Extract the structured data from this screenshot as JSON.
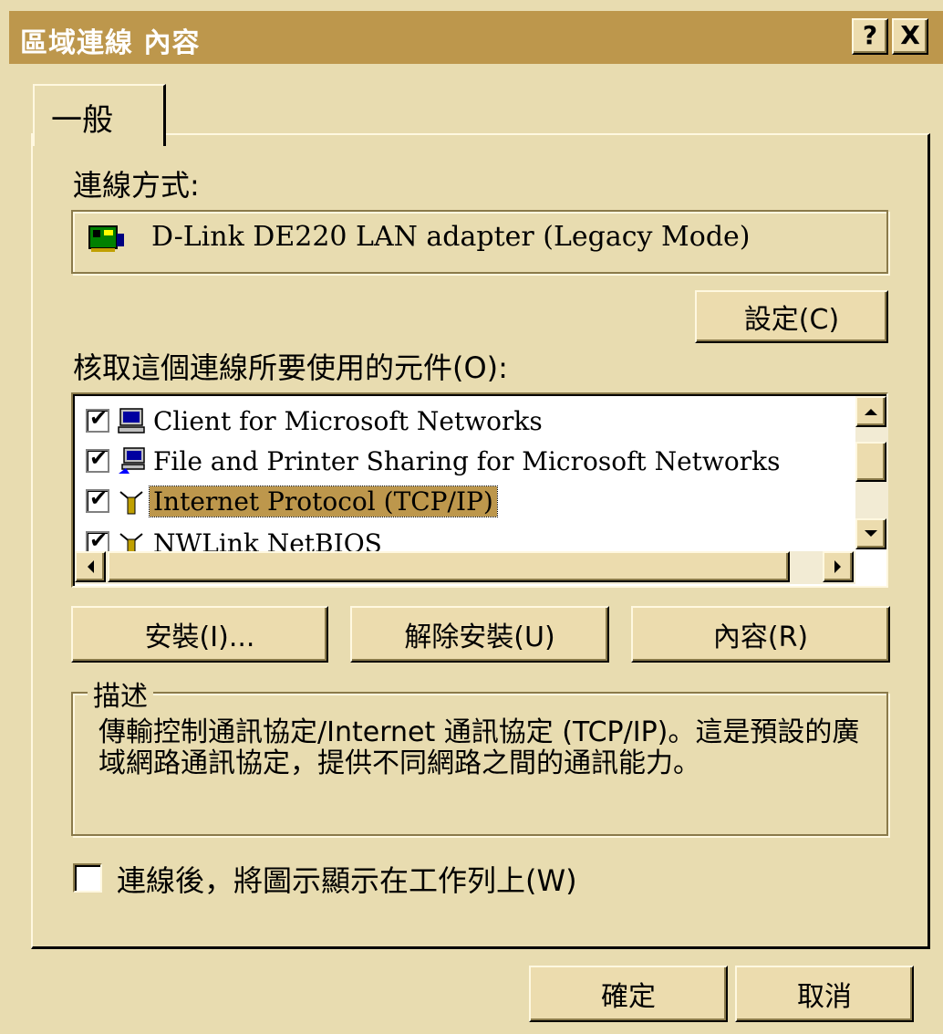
{
  "window": {
    "title": "區域連線 內容",
    "help_glyph": "?",
    "close_glyph": "X"
  },
  "tabs": [
    {
      "label": "一般"
    }
  ],
  "connect_using": {
    "label": "連線方式:",
    "adapter": "D-Link DE220 LAN adapter (Legacy Mode)",
    "adapter_icon": "network-card-icon"
  },
  "buttons": {
    "configure": "設定(C)",
    "install": "安裝(I)...",
    "uninstall": "解除安裝(U)",
    "properties": "內容(R)",
    "ok": "確定",
    "cancel": "取消"
  },
  "components": {
    "label": "核取這個連線所要使用的元件(O):",
    "items": [
      {
        "label": "Client for Microsoft Networks",
        "checked": true,
        "icon": "computer-icon"
      },
      {
        "label": "File and Printer Sharing for Microsoft Networks",
        "checked": true,
        "icon": "shared-computer-icon"
      },
      {
        "label": "Internet Protocol (TCP/IP)",
        "checked": true,
        "icon": "protocol-icon",
        "selected": true
      },
      {
        "label": "NWLink NetBIOS",
        "checked": true,
        "icon": "protocol-icon"
      }
    ]
  },
  "description": {
    "legend": "描述",
    "text": "傳輸控制通訊協定/Internet 通訊協定 (TCP/IP)。這是預設的廣域網路通訊協定，提供不同網路之間的通訊能力。"
  },
  "show_icon": {
    "label": "連線後，將圖示顯示在工作列上(W)",
    "checked": false
  },
  "colors": {
    "face": "#e8dcb0",
    "titlebar": "#bd974c",
    "selection": "#bd974c"
  }
}
